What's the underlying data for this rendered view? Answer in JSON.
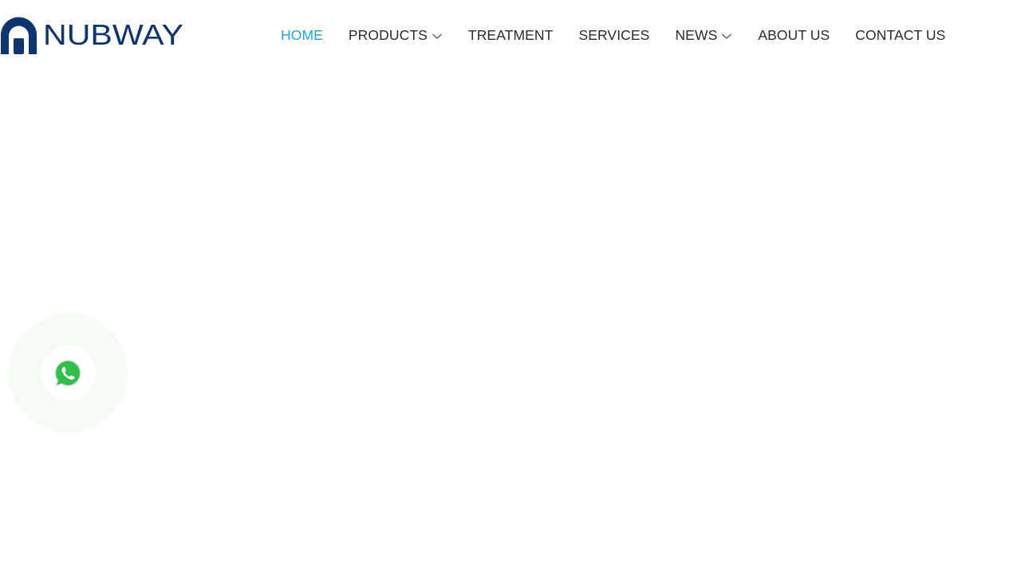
{
  "brand": {
    "name": "NUBWAY",
    "logo_color": "#0f3470"
  },
  "nav": {
    "items": [
      {
        "label": "HOME",
        "active": true,
        "dropdown": false
      },
      {
        "label": "PRODUCTS",
        "active": false,
        "dropdown": true,
        "icon": "chevron-down-icon"
      },
      {
        "label": "TREATMENT",
        "active": false,
        "dropdown": false
      },
      {
        "label": "SERVICES",
        "active": false,
        "dropdown": false
      },
      {
        "label": "NEWS",
        "active": false,
        "dropdown": true,
        "icon": "chevron-down-icon"
      },
      {
        "label": "ABOUT US",
        "active": false,
        "dropdown": false
      },
      {
        "label": "CONTACT US",
        "active": false,
        "dropdown": false
      }
    ],
    "active_color": "#22a3dc",
    "text_color": "#2b2b2b"
  },
  "floating_contact": {
    "icon": "whatsapp-icon",
    "color": "#2fbf4b"
  }
}
